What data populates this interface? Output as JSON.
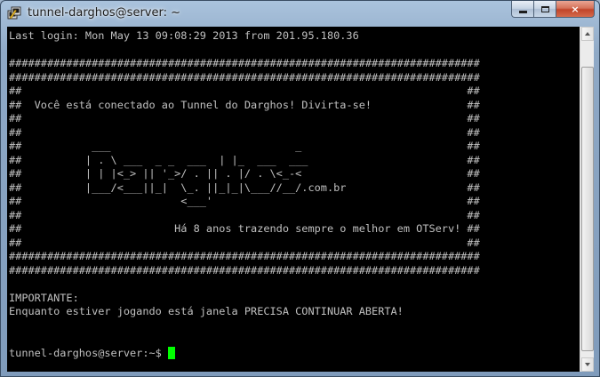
{
  "window": {
    "title": "tunnel-darghos@server: ~",
    "icon": "putty-terminal-icon",
    "controls": {
      "minimize": "minimize-icon",
      "maximize": "maximize-icon",
      "close": "×"
    }
  },
  "terminal": {
    "lines": [
      "Last login: Mon May 13 09:08:29 2013 from 201.95.180.36",
      "",
      "##########################################################################",
      "##########################################################################",
      "##                                                                      ##",
      "##  Você está conectado ao Tunnel do Darghos! Divirta-se!               ##",
      "##                                                                      ##",
      "##                                                                      ##",
      "##           ___                             _                          ##",
      "##          | . \\ ___  _ _  ___  | |_  ___  ___                         ##",
      "##          | | |<_> || '_>/ . || . |/ . \\<_-<                          ##",
      "##          |___/<___||_|  \\_. ||_|_|\\___//__/.com.br                   ##",
      "##                         <___'                                        ##",
      "##                                                                      ##",
      "##                        Há 8 anos trazendo sempre o melhor em OTServ! ##",
      "##                                                                      ##",
      "##########################################################################",
      "##########################################################################",
      "",
      "IMPORTANTE:",
      "Enquanto estiver jogando está janela PRECISA CONTINUAR ABERTA!",
      "",
      "",
      "tunnel-darghos@server:~$ "
    ],
    "cursor_color": "#00ff00",
    "text_color": "#c0c0c0",
    "background": "#000000"
  }
}
